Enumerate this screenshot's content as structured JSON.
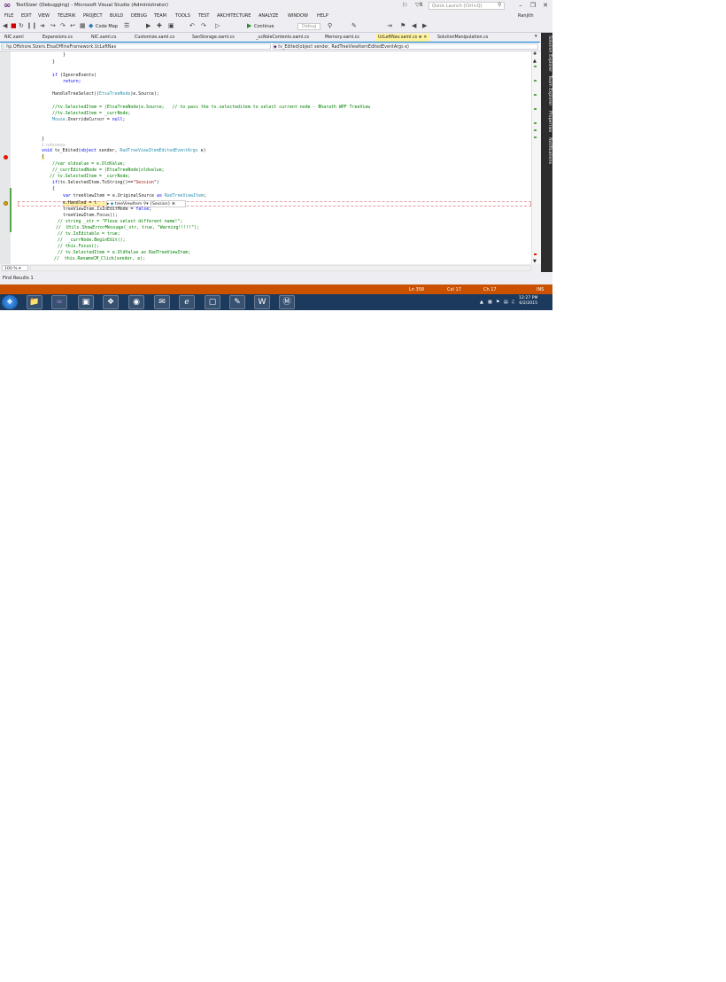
{
  "window": {
    "title": "TestSizer (Debugging) - Microsoft Visual Studio (Administrator)",
    "notification_count": "8",
    "quick_launch_placeholder": "Quick Launch (Ctrl+Q)",
    "user": "Ranjith"
  },
  "menu": [
    "FILE",
    "EDIT",
    "VIEW",
    "TELERIK",
    "PROJECT",
    "BUILD",
    "DEBUG",
    "TEAM",
    "TOOLS",
    "TEST",
    "ARCHITECTURE",
    "ANALYZE",
    "WINDOW",
    "HELP"
  ],
  "toolbar": {
    "code_map": "Code Map",
    "continue": "Continue",
    "config": "Debug"
  },
  "tabs": [
    "NIC.xaml",
    "Expansions.cs",
    "NIC.xaml.cs",
    "Customize.xaml.cs",
    "SanStorage.xaml.cs",
    "_ucRoleContents.xaml.cs",
    "Memory.xaml.cs",
    "UcLeftNav.xaml.cs",
    "SolutionManipulation.cs"
  ],
  "active_tab_index": 7,
  "right_panel": [
    "Solution Explorer",
    "Team Explorer",
    "Properties",
    "Notifications"
  ],
  "nav": {
    "left": "hp.Offshore.Sizers.EtsaOfflineFramework.UcLeftNav",
    "right": "tv_Edited(object sender, RadTreeViewItemEditedEventArgs e)"
  },
  "code": {
    "l1": "}",
    "l2": "}",
    "l3_kw": "if",
    "l3_rest": " (IgnoreEvents)",
    "l4": "return;",
    "l5a": "HandleTreeSelect((",
    "l5b": "EtsaTreeNode",
    "l5c": ")e.Source);",
    "l6": "//tv.SelectedItem = (EtsaTreeNode)e.Source;   // to pass the tv.selecteditem to select current node - Bharath WPF TreeView",
    "l7": "//tv.SelectedItem = _currNode;",
    "l8a": "Mouse",
    "l8b": ".OverrideCursor = ",
    "l8c": "null",
    "l8d": ";",
    "l9": "}",
    "refs": "1 reference",
    "l10a": "void",
    "l10b": " tv_Edited(",
    "l10c": "object",
    "l10d": " sender, ",
    "l10e": "RadTreeViewItemEditedEventArgs",
    "l10f": " e)",
    "l11": "{",
    "l12": "//var oldvalue = e.OldValue;",
    "l13": "//_currEditedNode = (EtsaTreeNode)oldvalue;",
    "l14": "// tv.SelectedItem = _currNode;",
    "l15a": "if",
    "l15b": "(tv.SelectedItem.ToString()==",
    "l15c": "\"Session\"",
    "l15d": ")",
    "l16": "{",
    "l17a": "var",
    "l17b": " treeViewItem = e.OriginalSource ",
    "l17c": "as",
    "l17d": " ",
    "l17e": "RadTreeViewItem",
    "l17f": ";",
    "l18": "e.Handled = t",
    "l19a": "treeViewItem.IsInEditMode = ",
    "l19b": "false",
    "l19c": ";",
    "l20": "treeViewItem.Focus();",
    "l21a": "// string _str = ",
    "l21b": "\"Plese select different name!\"",
    "l21c": ";",
    "l22": "//  Utils.ShowErrorMessage(_str, true, \"Warning!!!!!\");",
    "l23": "// tv.IsEditable = true;",
    "l24": "//  _currNode.BeginEdit();",
    "l25": "// this.Focus();",
    "l26": "// tv.SelectedItem = e.OldValue as RadTreeViewItem;",
    "l27": "//  this.RenameCM_Click(sender, e);"
  },
  "datatip": {
    "name": "treeViewItem",
    "value": "{Session}"
  },
  "zoom": "100 %",
  "find_results": "Find Results 1",
  "status": {
    "ln": "Ln 358",
    "col": "Col 17",
    "ch": "Ch 17",
    "mode": "INS"
  },
  "clock": {
    "time": "12:27 PM",
    "date": "6/2/2015"
  }
}
